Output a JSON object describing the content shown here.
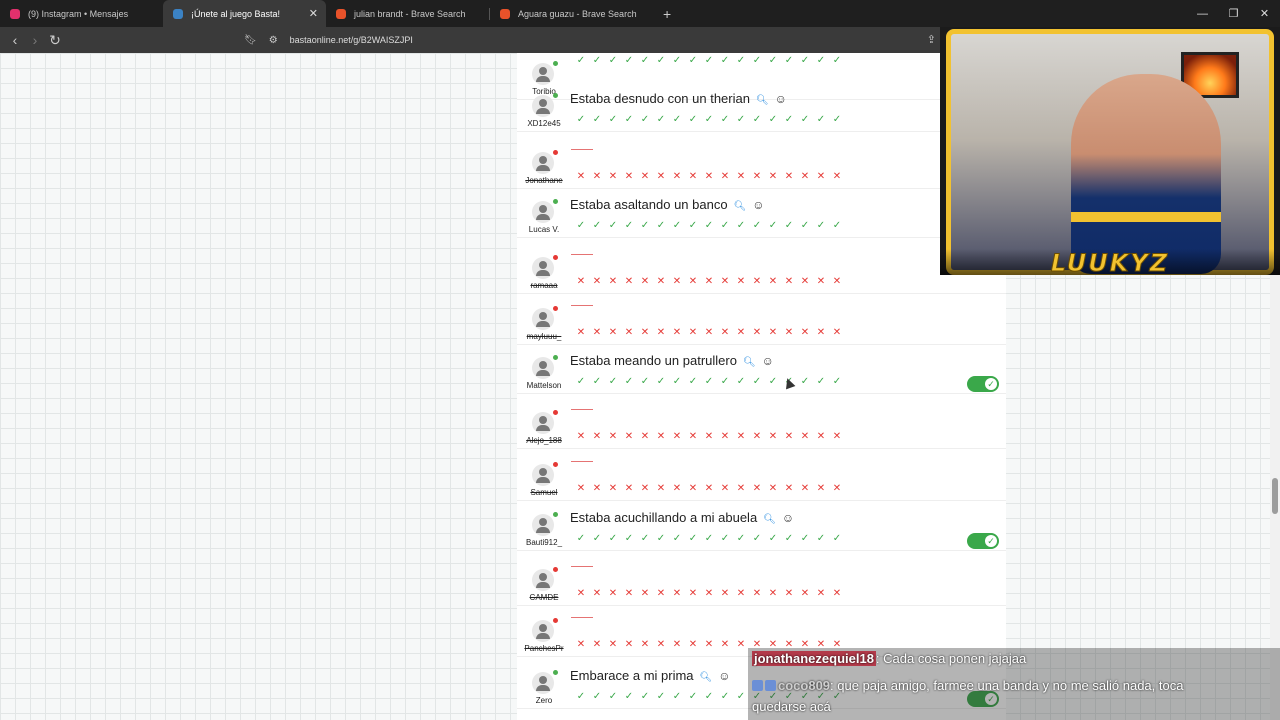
{
  "browser": {
    "tabs": [
      {
        "label": "(9) Instagram • Mensajes",
        "active": false,
        "favicon_color": "#e1306c"
      },
      {
        "label": "¡Únete al juego Basta!",
        "active": true,
        "favicon_color": "#3b82c4"
      },
      {
        "label": "julian brandt - Brave Search",
        "active": false,
        "favicon_color": "#e8522a"
      },
      {
        "label": "Aguara guazu - Brave Search",
        "active": false,
        "favicon_color": "#e8522a"
      }
    ],
    "new_tab": "+",
    "url": "bastaonline.net/g/B2WAISZJPI"
  },
  "results": [
    {
      "user": "Toribio",
      "status": "on",
      "answer": "",
      "marks": [
        "ok",
        "ok",
        "ok",
        "ok",
        "ok",
        "ok",
        "ok",
        "ok",
        "ok",
        "ok",
        "ok",
        "ok",
        "ok",
        "ok",
        "ok",
        "ok",
        "ok"
      ],
      "toggle": false
    },
    {
      "user": "XD12e45",
      "status": "on",
      "answer": "Estaba desnudo con un therian",
      "marks": [
        "ok",
        "ok",
        "ok",
        "ok",
        "ok",
        "ok",
        "ok",
        "ok",
        "ok",
        "ok",
        "ok",
        "ok",
        "ok",
        "ok",
        "ok",
        "ok",
        "ok"
      ],
      "toggle": false
    },
    {
      "user": "Jonathane",
      "status": "off",
      "answer": "",
      "marks": [
        "no",
        "no",
        "no",
        "no",
        "no",
        "no",
        "no",
        "no",
        "no",
        "no",
        "no",
        "no",
        "no",
        "no",
        "no",
        "no",
        "no"
      ],
      "toggle": false
    },
    {
      "user": "Lucas V.",
      "status": "on",
      "answer": "Estaba asaltando un banco",
      "marks": [
        "ok",
        "ok",
        "ok",
        "ok",
        "ok",
        "ok",
        "ok",
        "ok",
        "ok",
        "ok",
        "ok",
        "ok",
        "ok",
        "ok",
        "ok",
        "ok",
        "ok"
      ],
      "toggle": false
    },
    {
      "user": "ramaaa",
      "status": "off",
      "answer": "",
      "marks": [
        "no",
        "no",
        "no",
        "no",
        "no",
        "no",
        "no",
        "no",
        "no",
        "no",
        "no",
        "no",
        "no",
        "no",
        "no",
        "no",
        "no"
      ],
      "toggle": false
    },
    {
      "user": "mayluuu_",
      "status": "off",
      "answer": "",
      "marks": [
        "no",
        "no",
        "no",
        "no",
        "no",
        "no",
        "no",
        "no",
        "no",
        "no",
        "no",
        "no",
        "no",
        "no",
        "no",
        "no",
        "no"
      ],
      "toggle": false
    },
    {
      "user": "Mattelson",
      "status": "on",
      "answer": "Estaba meando un patrullero",
      "marks": [
        "ok",
        "ok",
        "ok",
        "ok",
        "ok",
        "ok",
        "ok",
        "ok",
        "ok",
        "ok",
        "ok",
        "ok",
        "ok",
        "ok",
        "ok",
        "ok",
        "ok"
      ],
      "toggle": true
    },
    {
      "user": "Alejo_188",
      "status": "off",
      "answer": "",
      "marks": [
        "no",
        "no",
        "no",
        "no",
        "no",
        "no",
        "no",
        "no",
        "no",
        "no",
        "no",
        "no",
        "no",
        "no",
        "no",
        "no",
        "no"
      ],
      "toggle": false
    },
    {
      "user": "Samuel",
      "status": "off",
      "answer": "",
      "marks": [
        "no",
        "no",
        "no",
        "no",
        "no",
        "no",
        "no",
        "no",
        "no",
        "no",
        "no",
        "no",
        "no",
        "no",
        "no",
        "no",
        "no"
      ],
      "toggle": false
    },
    {
      "user": "Bauti912_",
      "status": "on",
      "answer": "Estaba acuchillando a mi abuela",
      "marks": [
        "ok",
        "ok",
        "ok",
        "ok",
        "ok",
        "ok",
        "ok",
        "ok",
        "ok",
        "ok",
        "ok",
        "ok",
        "ok",
        "ok",
        "ok",
        "ok",
        "ok"
      ],
      "toggle": true
    },
    {
      "user": "CAMDE",
      "status": "off",
      "answer": "",
      "marks": [
        "no",
        "no",
        "no",
        "no",
        "no",
        "no",
        "no",
        "no",
        "no",
        "no",
        "no",
        "no",
        "no",
        "no",
        "no",
        "no",
        "no"
      ],
      "toggle": false
    },
    {
      "user": "PanchesPr",
      "status": "off",
      "answer": "",
      "marks": [
        "no",
        "no",
        "no",
        "no",
        "no",
        "no",
        "no",
        "no",
        "no",
        "no",
        "no",
        "no",
        "no",
        "no",
        "no",
        "no",
        "no"
      ],
      "toggle": false
    },
    {
      "user": "Zero",
      "status": "on",
      "answer": "Embarace a mi prima",
      "marks": [
        "ok",
        "ok",
        "ok",
        "ok",
        "ok",
        "ok",
        "ok",
        "ok",
        "ok",
        "ok",
        "ok",
        "ok",
        "ok",
        "ok",
        "ok",
        "ok",
        "ok"
      ],
      "toggle": true
    }
  ],
  "icons": {
    "search": "magnifier-icon",
    "emoji": "smiley-icon"
  },
  "webcam": {
    "brand": "LUUKYZ"
  },
  "chat": [
    {
      "user": "jonathanezequiel18",
      "text": ": Cada cosa ponen jajajaa"
    },
    {
      "user": "coco809",
      "text": ": que paja amigo, farmee una banda y no me salió nada, toca",
      "cont": "quedarse acá"
    }
  ]
}
